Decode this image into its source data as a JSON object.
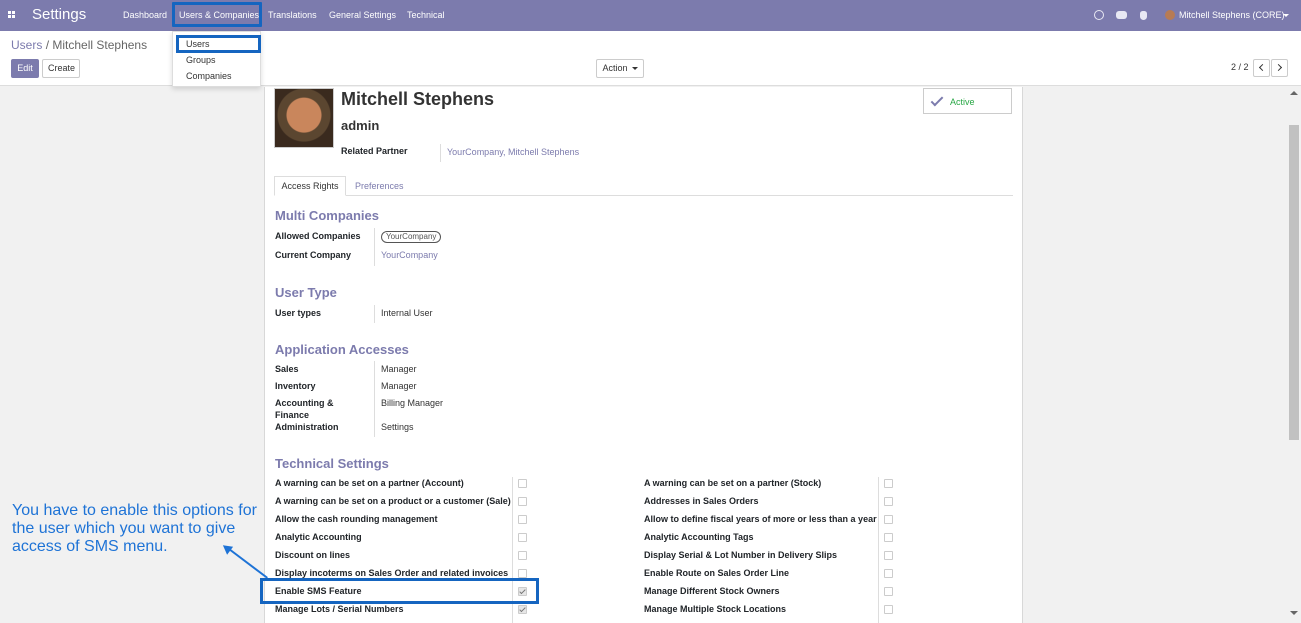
{
  "topbar": {
    "app_title": "Settings",
    "menu": [
      "Dashboard",
      "Users & Companies",
      "Translations",
      "General Settings",
      "Technical"
    ],
    "user_name": "Mitchell Stephens (CORE)"
  },
  "dropdown": {
    "items": [
      "Users",
      "Groups",
      "Companies"
    ]
  },
  "breadcrumb": {
    "parent": "Users",
    "separator": "/",
    "current": "Mitchell Stephens"
  },
  "controls": {
    "edit": "Edit",
    "create": "Create",
    "action": "Action",
    "pager": "2 / 2"
  },
  "record": {
    "name": "Mitchell Stephens",
    "login": "admin",
    "related_partner_label": "Related Partner",
    "related_partner_value": "YourCompany, Mitchell Stephens",
    "status": "Active"
  },
  "tabs": [
    "Access Rights",
    "Preferences"
  ],
  "multi_companies": {
    "title": "Multi Companies",
    "allowed_label": "Allowed Companies",
    "allowed_tag": "YourCompany",
    "current_label": "Current Company",
    "current_value": "YourCompany"
  },
  "user_type": {
    "title": "User Type",
    "label": "User types",
    "value": "Internal User"
  },
  "app_accesses": {
    "title": "Application Accesses",
    "rows": [
      {
        "label": "Sales",
        "value": "Manager"
      },
      {
        "label": "Inventory",
        "value": "Manager"
      },
      {
        "label": "Accounting & Finance",
        "value": "Billing Manager"
      },
      {
        "label": "Administration",
        "value": "Settings"
      }
    ]
  },
  "technical": {
    "title": "Technical Settings",
    "left": [
      {
        "label": "A warning can be set on a partner (Account)",
        "checked": false
      },
      {
        "label": "A warning can be set on a product or a customer (Sale)",
        "checked": false
      },
      {
        "label": "Allow the cash rounding management",
        "checked": false
      },
      {
        "label": "Analytic Accounting",
        "checked": false
      },
      {
        "label": "Discount on lines",
        "checked": false
      },
      {
        "label": "Display incoterms on Sales Order and related invoices",
        "checked": false
      },
      {
        "label": "Enable SMS Feature",
        "checked": true
      },
      {
        "label": "Manage Lots / Serial Numbers",
        "checked": true
      }
    ],
    "right": [
      {
        "label": "A warning can be set on a partner (Stock)",
        "checked": false
      },
      {
        "label": "Addresses in Sales Orders",
        "checked": false
      },
      {
        "label": "Allow to define fiscal years of more or less than a year",
        "checked": false
      },
      {
        "label": "Analytic Accounting Tags",
        "checked": false
      },
      {
        "label": "Display Serial & Lot Number in Delivery Slips",
        "checked": false
      },
      {
        "label": "Enable Route on Sales Order Line",
        "checked": false
      },
      {
        "label": "Manage Different Stock Owners",
        "checked": false
      },
      {
        "label": "Manage Multiple Stock Locations",
        "checked": false
      }
    ]
  },
  "annotation": {
    "text": "You have to enable this options for the user which you want to give access of SMS menu."
  },
  "colors": {
    "brand": "#7c7bad",
    "highlight": "#1565c0",
    "annotation": "#1e73d6",
    "active": "#28a745"
  }
}
